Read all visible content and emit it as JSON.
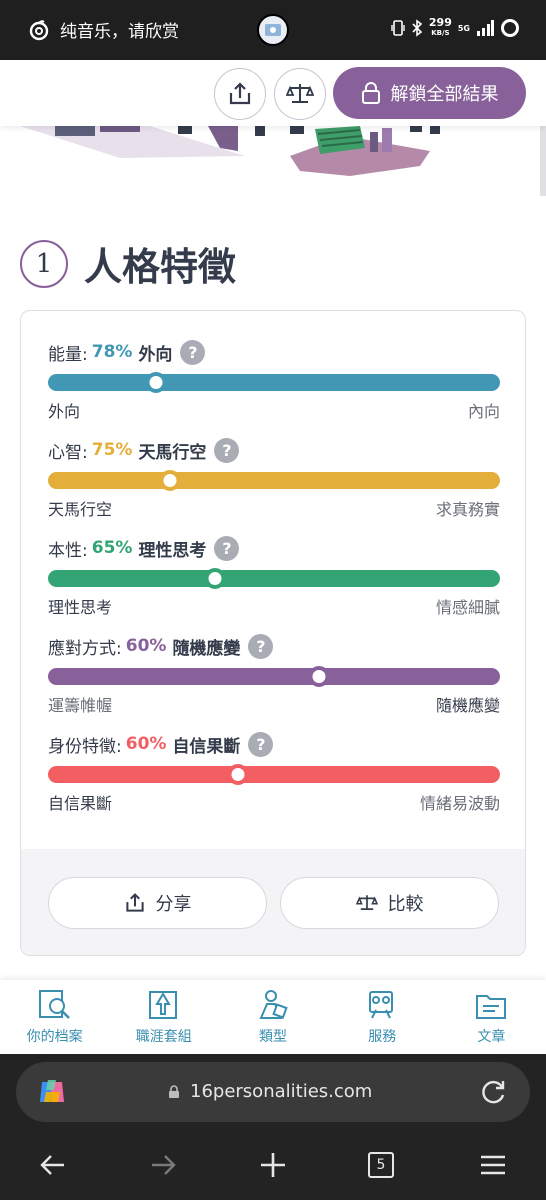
{
  "status_bar": {
    "now_playing": "纯音乐，请欣赏",
    "net_speed_value": "299",
    "net_speed_unit": "KB/S",
    "network": "5G"
  },
  "top_actions": {
    "unlock_label": "解鎖全部結果"
  },
  "section": {
    "number": "1",
    "title": "人格特徵"
  },
  "traits": [
    {
      "name": "能量:",
      "percent": "78%",
      "dominant": "外向",
      "color": "#4298b4",
      "left_label": "外向",
      "right_label": "內向",
      "left_strong": true,
      "position": 0.24
    },
    {
      "name": "心智:",
      "percent": "75%",
      "dominant": "天馬行空",
      "color": "#e4ae3a",
      "left_label": "天馬行空",
      "right_label": "求真務實",
      "left_strong": true,
      "position": 0.27
    },
    {
      "name": "本性:",
      "percent": "65%",
      "dominant": "理性思考",
      "color": "#33a474",
      "left_label": "理性思考",
      "right_label": "情感細膩",
      "left_strong": true,
      "position": 0.37
    },
    {
      "name": "應對方式:",
      "percent": "60%",
      "dominant": "隨機應變",
      "color": "#88619a",
      "left_label": "運籌帷幄",
      "right_label": "隨機應變",
      "left_strong": false,
      "position": 0.6
    },
    {
      "name": "身份特徵:",
      "percent": "60%",
      "dominant": "自信果斷",
      "color": "#f25e62",
      "left_label": "自信果斷",
      "right_label": "情緒易波動",
      "left_strong": true,
      "position": 0.42
    }
  ],
  "help_glyph": "?",
  "card_actions": {
    "share_label": "分享",
    "compare_label": "比較"
  },
  "site_nav": [
    {
      "label": "你的档案",
      "icon": "profile-search-icon"
    },
    {
      "label": "職涯套組",
      "icon": "career-kit-icon"
    },
    {
      "label": "類型",
      "icon": "types-icon"
    },
    {
      "label": "服務",
      "icon": "services-icon"
    },
    {
      "label": "文章",
      "icon": "articles-icon"
    }
  ],
  "browser": {
    "url": "16personalities.com",
    "tab_count": "5"
  },
  "colors": {
    "accent_purple": "#88619a",
    "nav_blue": "#3a8fb0"
  }
}
